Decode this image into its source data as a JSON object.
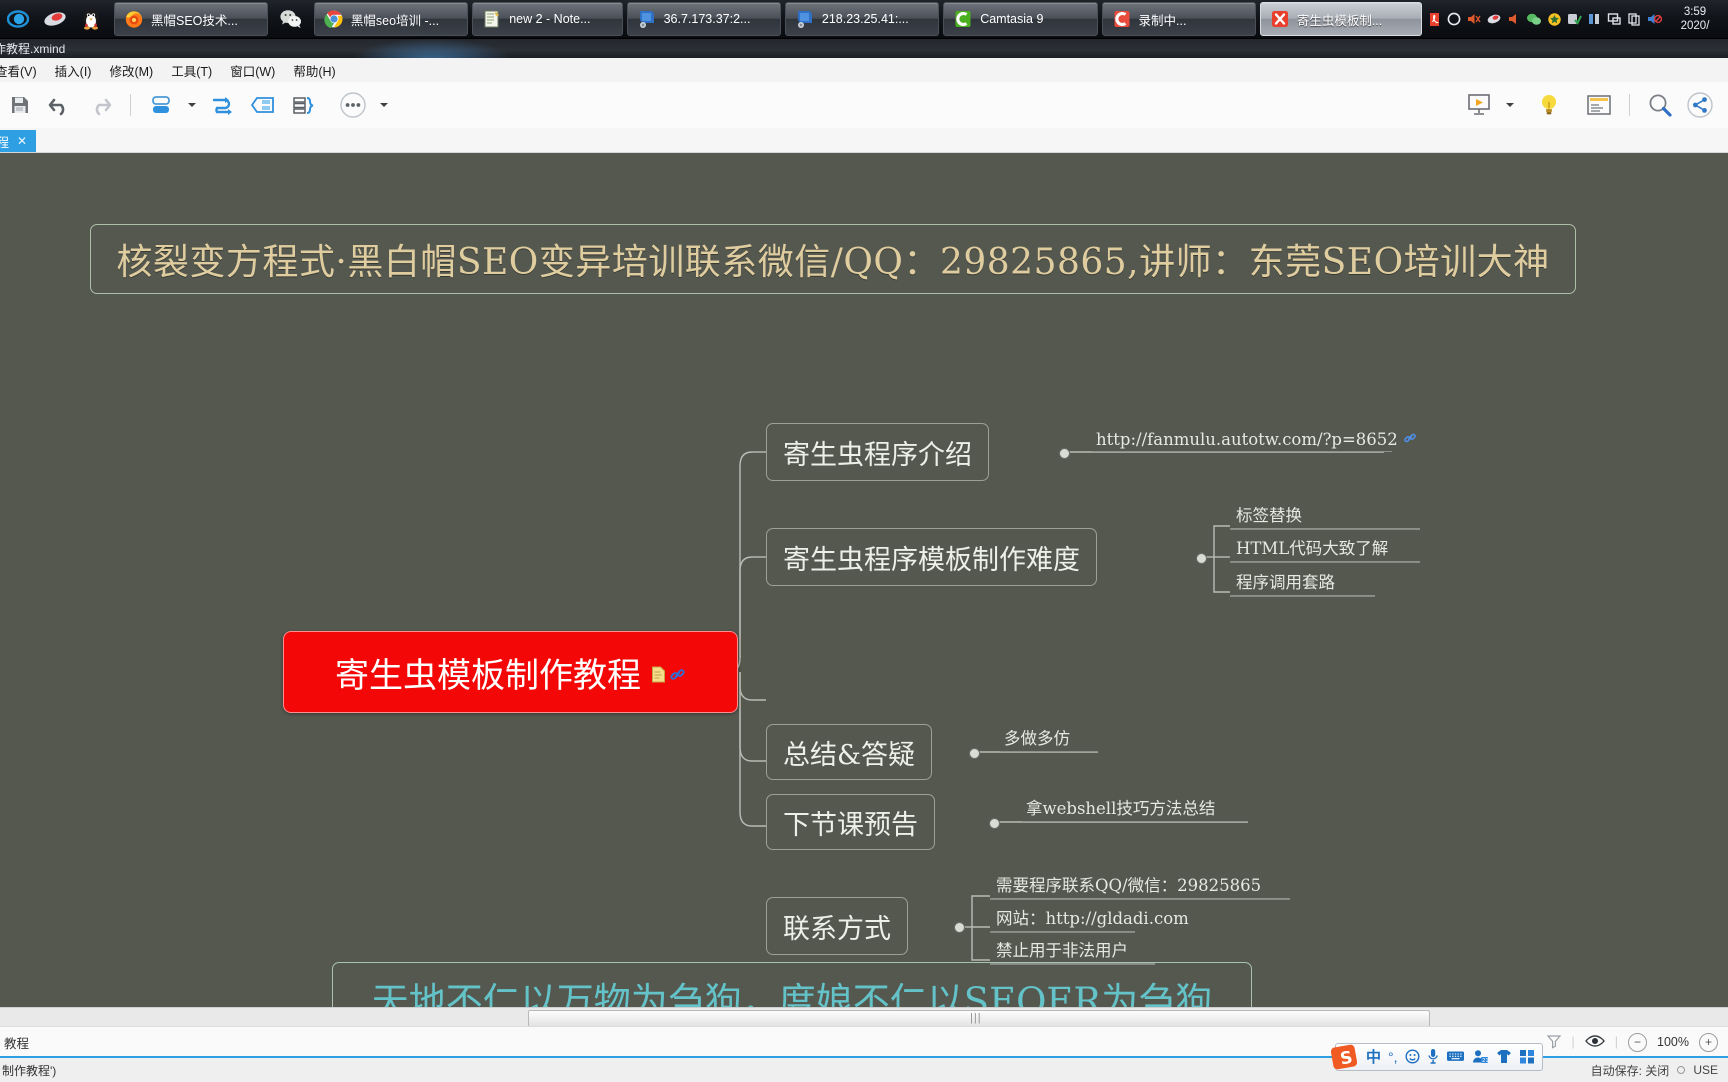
{
  "taskbar": {
    "quick_icons": [
      "ie-icon",
      "media-player-icon",
      "qq-penguin-icon"
    ],
    "buttons": [
      {
        "label": "黑帽SEO技术...",
        "icon": "firefox-icon",
        "active": false
      },
      {
        "label": "",
        "icon": "wechat-icon",
        "active": false,
        "quick": true
      },
      {
        "label": "黑帽seo培训 -...",
        "icon": "chrome-icon",
        "active": false
      },
      {
        "label": "new 2 - Note...",
        "icon": "notepadpp-icon",
        "active": false
      },
      {
        "label": "36.7.173.37:2...",
        "icon": "remote-desktop-icon",
        "active": false
      },
      {
        "label": "218.23.25.41:...",
        "icon": "remote-desktop-icon",
        "active": false
      },
      {
        "label": "Camtasia 9",
        "icon": "camtasia-icon",
        "active": false
      },
      {
        "label": "录制中...",
        "icon": "camtasia-recorder-icon",
        "active": false
      },
      {
        "label": "寄生虫模板制...",
        "icon": "xmind-icon",
        "active": true
      }
    ],
    "tray_icons": [
      "acrobat-icon",
      "circle-icon",
      "speaker-mute-icon",
      "mouse-icon",
      "volume-icon",
      "wechat-tray-icon",
      "security-shield-icon",
      "antivirus-check-icon",
      "network-icon",
      "screen-icon",
      "copy-icon",
      "sound-off-icon"
    ],
    "clock_time": "3:59",
    "clock_date": "2020/"
  },
  "window": {
    "title": "作教程.xmind"
  },
  "menubar": {
    "items": [
      "查看(V)",
      "插入(I)",
      "修改(M)",
      "工具(T)",
      "窗口(W)",
      "帮助(H)"
    ]
  },
  "toolbar": {
    "left_tools": [
      "save-icon",
      "undo-icon",
      "redo-icon",
      "separator",
      "topic-style-icon",
      "dropdown-caret",
      "relationship-icon",
      "boundary-icon",
      "summary-icon",
      "more-icon",
      "more-caret"
    ],
    "right_tools": [
      "presentation-icon",
      "presentation-caret",
      "brainstorm-bulb-icon",
      "outline-icon",
      "separator",
      "zoom-search-icon",
      "share-icon"
    ]
  },
  "sheet_tabs": {
    "active_label": "教程",
    "close_label": "✕"
  },
  "map": {
    "top_banner": "核裂变方程式·黑白帽SEO变异培训联系微信/QQ：29825865,讲师：东莞SEO培训大神",
    "bottom_banner": "天地不仁以万物为刍狗，度娘不仁以SEOER为刍狗",
    "root": {
      "label": "寄生虫模板制作教程",
      "icons": [
        "note-icon",
        "hyperlink-icon"
      ],
      "fill_color": "#f40707",
      "text_color": "#ffffff"
    },
    "branches": [
      {
        "label": "寄生虫程序介绍",
        "children": [
          {
            "label": "http://fanmulu.autotw.com/?p=8652",
            "icon": "hyperlink-icon"
          }
        ]
      },
      {
        "label": "寄生虫程序模板制作难度",
        "children": [
          {
            "label": "标签替换"
          },
          {
            "label": "HTML代码大致了解"
          },
          {
            "label": "程序调用套路"
          }
        ]
      },
      {
        "label": "总结&答疑",
        "children": [
          {
            "label": "多做多仿"
          }
        ]
      },
      {
        "label": "下节课预告",
        "children": [
          {
            "label": "拿webshell技巧方法总结"
          }
        ]
      },
      {
        "label": "联系方式",
        "children": [
          {
            "label": "需要程序联系QQ/微信：29825865"
          },
          {
            "label": "网站：http://gldadi.com"
          },
          {
            "label": "禁止用于非法用户"
          }
        ]
      }
    ]
  },
  "statusbar": {
    "left_text": "教程",
    "zoom_minus": "−",
    "zoom_value": "100%",
    "zoom_plus": "+",
    "filter_icon": "filter-icon",
    "eye_icon": "eye-icon"
  },
  "bottombar": {
    "left_text": "制作教程')",
    "autosave_text": "自动保存: 关闭",
    "usb_text": "USE"
  },
  "ime": {
    "logo": "sogou-icon",
    "mode": "中",
    "punct": "°,",
    "items": [
      "smiley-icon",
      "mic-icon",
      "keyboard-icon",
      "user-icon",
      "skin-icon",
      "apps-icon"
    ]
  },
  "colors": {
    "canvas_bg": "#55584f",
    "root_fill": "#f40707",
    "top_banner_text": "#dfcda0",
    "bottom_banner_text": "#63c3c9",
    "accent": "#2f9fe3"
  }
}
